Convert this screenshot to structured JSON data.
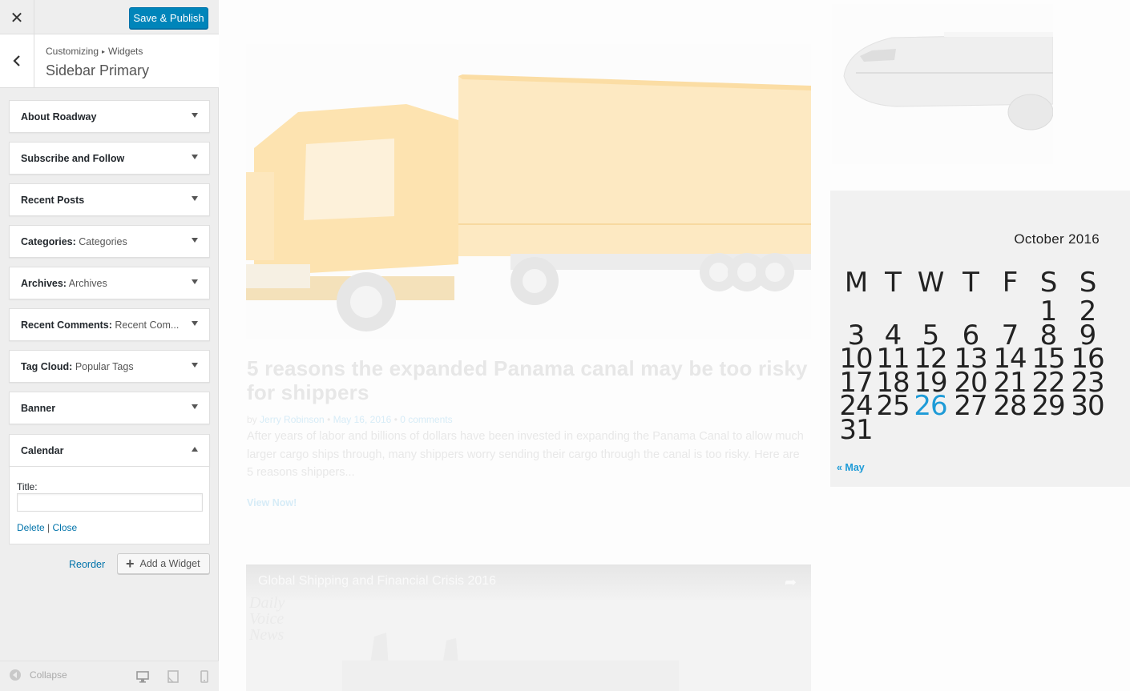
{
  "customizer": {
    "close_icon": "close-icon",
    "save_label": "Save & Publish",
    "breadcrumb": [
      "Customizing",
      "Widgets"
    ],
    "section_title": "Sidebar Primary",
    "widgets": [
      {
        "name": "About Roadway",
        "subtitle": ""
      },
      {
        "name": "Subscribe and Follow",
        "subtitle": ""
      },
      {
        "name": "Recent Posts",
        "subtitle": ""
      },
      {
        "name": "Categories:",
        "subtitle": "Categories"
      },
      {
        "name": "Archives:",
        "subtitle": "Archives"
      },
      {
        "name": "Recent Comments:",
        "subtitle": "Recent Com..."
      },
      {
        "name": "Tag Cloud:",
        "subtitle": "Popular Tags"
      },
      {
        "name": "Banner",
        "subtitle": ""
      },
      {
        "name": "Calendar",
        "subtitle": ""
      }
    ],
    "calendar_widget": {
      "title_label": "Title:",
      "title_value": "",
      "delete_label": "Delete",
      "separator": "|",
      "close_label": "Close"
    },
    "reorder_label": "Reorder",
    "add_widget_label": "Add a Widget",
    "collapse_label": "Collapse"
  },
  "preview": {
    "post": {
      "title": "5 reasons the expanded Panama canal may be too risky for shippers",
      "by": "by",
      "author": "Jerry Robinson",
      "date": "May 16, 2016",
      "comments": "0 comments",
      "excerpt": "After years of labor and billions of dollars have been invested in expanding the Panama Canal to allow much larger cargo ships through, many shippers worry sending their cargo through the canal is too risky. Here are 5 reasons shippers...",
      "read_more": "View Now!"
    },
    "video": {
      "title": "Global Shipping and Financial Crisis 2016",
      "logo": [
        "Daily",
        "Voice",
        "News"
      ]
    },
    "calendar": {
      "caption": "October 2016",
      "weekdays": [
        "M",
        "T",
        "W",
        "T",
        "F",
        "S",
        "S"
      ],
      "first_weekday_index": 5,
      "days_in_month": 31,
      "today": 26,
      "today_color": "#1e9bd7",
      "prev_link": "« May"
    }
  }
}
